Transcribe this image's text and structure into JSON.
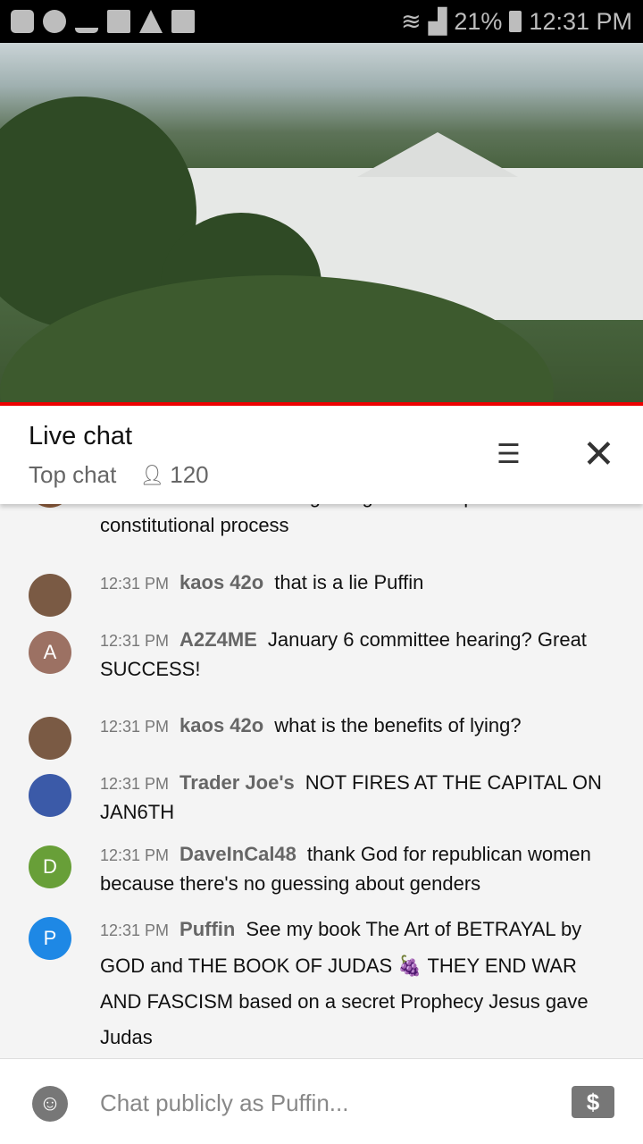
{
  "status_bar": {
    "battery": "21%",
    "time": "12:31 PM",
    "left_icons": [
      "youtube-icon",
      "messenger-icon",
      "missed-call-icon",
      "folder-icon",
      "warning-icon",
      "image-icon"
    ]
  },
  "header": {
    "title": "Live chat",
    "mode": "Top chat",
    "viewers": "120"
  },
  "messages": [
    {
      "time": "",
      "author": "",
      "text": "not the same as storming Congress to stop a constitutional process",
      "avatar_color": "#8a5a3a",
      "avatar_letter": ""
    },
    {
      "time": "12:31 PM",
      "author": "kaos 42o",
      "text": "that is a lie Puffin",
      "avatar_color": "#7a5a44",
      "avatar_letter": ""
    },
    {
      "time": "12:31 PM",
      "author": "A2Z4ME",
      "text": "January 6 committee hearing? Great SUCCESS!",
      "avatar_color": "#9c7163",
      "avatar_letter": "A"
    },
    {
      "time": "12:31 PM",
      "author": "kaos 42o",
      "text": "what is the benefits of lying?",
      "avatar_color": "#7a5a44",
      "avatar_letter": ""
    },
    {
      "time": "12:31 PM",
      "author": "Trader Joe's",
      "text": "NOT FIRES AT THE CAPITAL ON JAN6TH",
      "avatar_color": "#3b5aa8",
      "avatar_letter": ""
    },
    {
      "time": "12:31 PM",
      "author": "DaveInCal48",
      "text": "thank God for republican women because there's no guessing about genders",
      "avatar_color": "#689f38",
      "avatar_letter": "D"
    },
    {
      "time": "12:31 PM",
      "author": "Puffin",
      "text": "See my book The Art of BETRAYAL by GOD and THE BOOK OF JUDAS 🍇 THEY END WAR AND FASCISM based on a secret Prophecy Jesus gave Judas",
      "avatar_color": "#1e88e5",
      "avatar_letter": "P"
    }
  ],
  "input": {
    "placeholder": "Chat publicly as Puffin..."
  },
  "colors": {
    "accent": "#e00000"
  }
}
